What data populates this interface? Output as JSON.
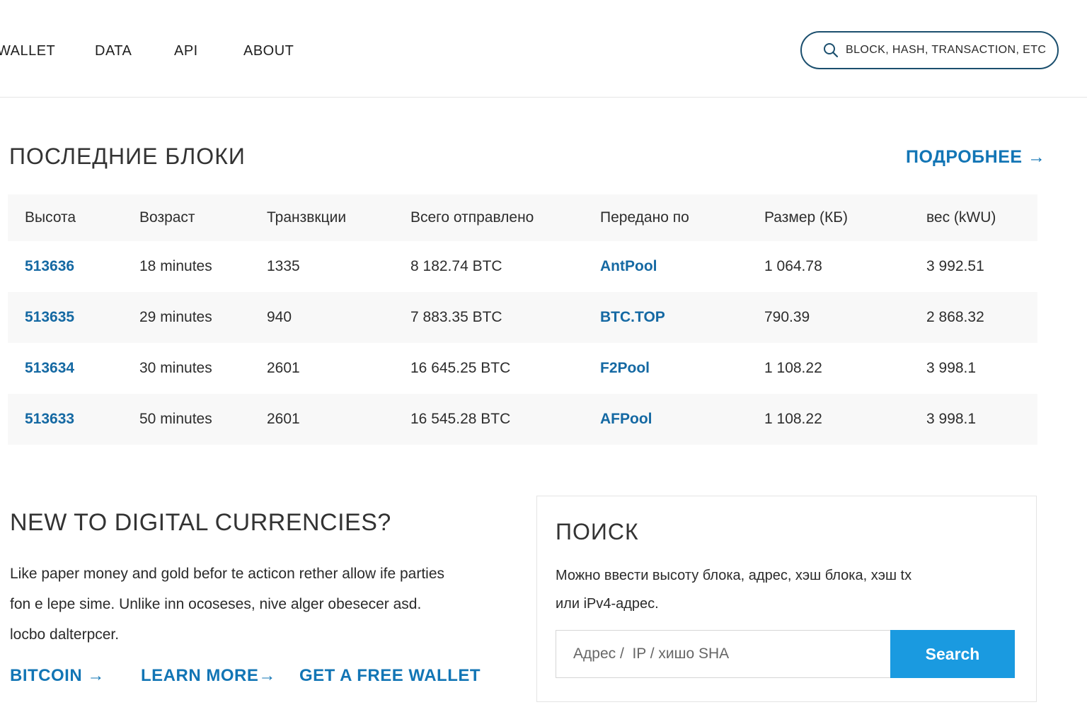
{
  "nav": {
    "items": [
      "WALLET",
      "DATA",
      "API",
      "ABOUT"
    ],
    "search_placeholder": "BLOCK, HASH, TRANSACTION, ETC"
  },
  "latest_blocks": {
    "title": "ПОСЛЕДНИЕ БЛОКИ",
    "more_link": "ПОДРОБНЕЕ →",
    "columns": [
      "Высота",
      "Возраст",
      "Транзвкции",
      "Всего отправлено",
      "Передано по",
      "Размер (КБ)",
      "вес (kWU)"
    ],
    "rows": [
      {
        "height": "513636",
        "age": "18 minutes",
        "tx": "1335",
        "sent": "8 182.74 BTC",
        "relayed": "AntPool",
        "size": "1 064.78",
        "weight": "3 992.51"
      },
      {
        "height": "513635",
        "age": "29 minutes",
        "tx": "940",
        "sent": "7 883.35 BTC",
        "relayed": "BTC.TOP",
        "size": "790.39",
        "weight": "2 868.32"
      },
      {
        "height": "513634",
        "age": "30 minutes",
        "tx": "2601",
        "sent": "16 645.25 BTC",
        "relayed": "F2Pool",
        "size": "1 108.22",
        "weight": "3 998.1"
      },
      {
        "height": "513633",
        "age": "50 minutes",
        "tx": "2601",
        "sent": "16 545.28 BTC",
        "relayed": "AFPool",
        "size": "1 108.22",
        "weight": "3 998.1"
      }
    ]
  },
  "intro": {
    "title": "NEW TO DIGITAL CURRENCIES?",
    "lines": [
      "Like paper money and gold befor te acticon rether allow ife parties",
      "fon e lepe sime. Unlike inn ocoseses, nive alger obesecer asd.",
      "locbo dalterpcer."
    ],
    "links": [
      "BITCOIN →",
      "LEARN MORE→",
      "GET A FREE WALLET"
    ]
  },
  "search_panel": {
    "title": "ПОИСК",
    "description_lines": [
      "Можно ввести высоту блока, адрес, хэш блока, хэш tx",
      "или iPv4-адрес."
    ],
    "input_placeholder": "Адрес /  IP / хишо SHA",
    "button_label": "Search"
  },
  "colors": {
    "accent": "#1275b5",
    "button": "#1a9ae0",
    "pill_border": "#1b4f6e"
  }
}
